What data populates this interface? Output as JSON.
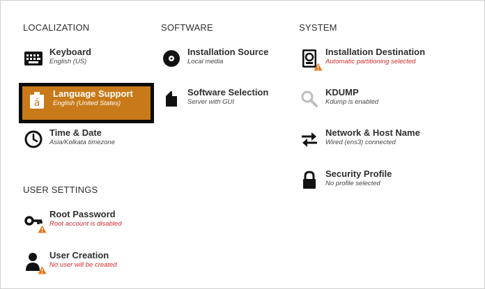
{
  "sections": {
    "localization": "LOCALIZATION",
    "software": "SOFTWARE",
    "system": "SYSTEM",
    "user_settings": "USER SETTINGS"
  },
  "spokes": {
    "keyboard": {
      "title": "Keyboard",
      "status": "English (US)",
      "icon": "keyboard-icon"
    },
    "language": {
      "title": "Language Support",
      "status": "English (United States)",
      "icon": "language-icon"
    },
    "time": {
      "title": "Time & Date",
      "status": "Asia/Kolkata timezone",
      "icon": "clock-icon"
    },
    "install_source": {
      "title": "Installation Source",
      "status": "Local media",
      "icon": "disc-icon"
    },
    "software_selection": {
      "title": "Software Selection",
      "status": "Server with GUI",
      "icon": "package-icon"
    },
    "install_dest": {
      "title": "Installation Destination",
      "status": "Automatic partitioning selected",
      "icon": "hard-disk-icon"
    },
    "kdump": {
      "title": "KDUMP",
      "status": "Kdump is enabled",
      "icon": "search-icon"
    },
    "network": {
      "title": "Network & Host Name",
      "status": "Wired (ens3) connected",
      "icon": "network-arrows-icon"
    },
    "security": {
      "title": "Security Profile",
      "status": "No profile selected",
      "icon": "lock-icon"
    },
    "root_password": {
      "title": "Root Password",
      "status": "Root account is disabled",
      "icon": "key-icon"
    },
    "user_creation": {
      "title": "User Creation",
      "status": "No user will be created",
      "icon": "user-icon"
    }
  },
  "colors": {
    "selected_bg": "#c87919",
    "warning_text": "#d12a2a",
    "warning_badge": "#e8751a"
  }
}
